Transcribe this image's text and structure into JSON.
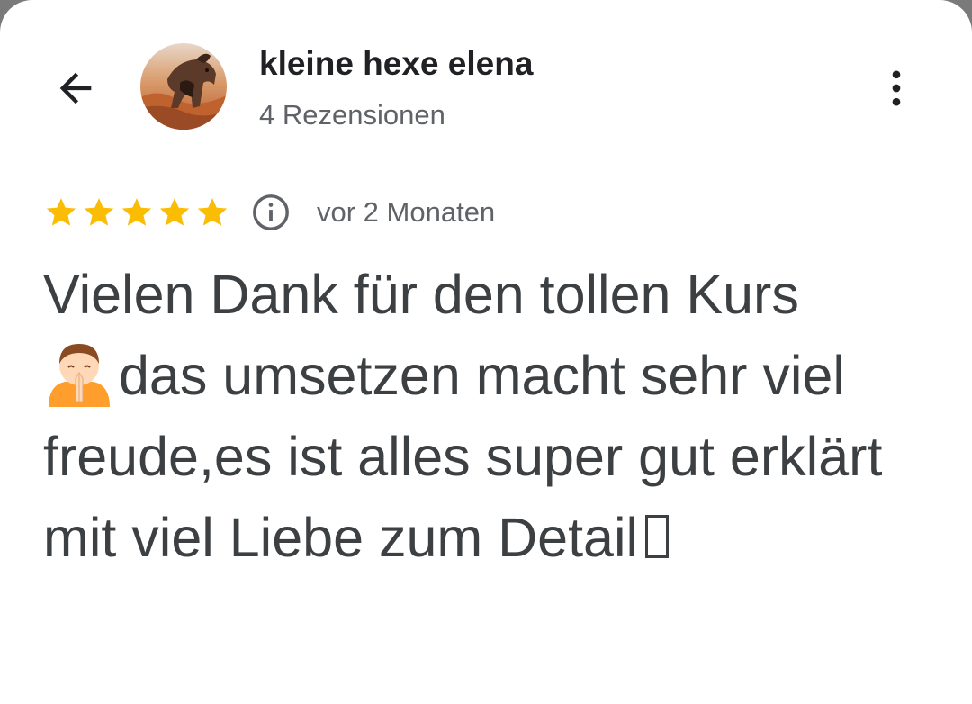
{
  "header": {
    "back_icon": "arrow-back-icon",
    "avatar_icon": "horse-photo-avatar",
    "reviewer_name": "kleine hexe elena",
    "review_count": "4 Rezensionen",
    "more_icon": "more-vert-icon"
  },
  "review": {
    "rating": 5,
    "rating_max": 5,
    "star_color": "#fbbc04",
    "info_icon": "info-icon",
    "date": "vor 2 Monaten",
    "text_part1": "Vielen Dank für den tollen Kurs",
    "emoji": "person-with-folded-hands-emoji",
    "text_part2": "das umsetzen macht sehr viel freude,es ist alles super gut erklärt mit viel Liebe zum Detail",
    "trailing_glyph": "missing-glyph-box"
  },
  "colors": {
    "text_primary": "#202124",
    "text_secondary": "#5f6368",
    "body_text": "#3c4043",
    "background": "#ffffff"
  }
}
